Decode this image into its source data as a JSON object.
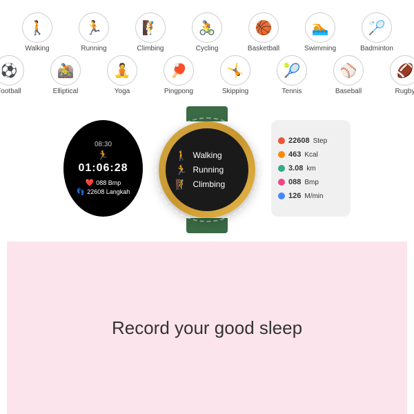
{
  "activities_row1": [
    {
      "label": "Walking",
      "icon": "🚶"
    },
    {
      "label": "Running",
      "icon": "🏃"
    },
    {
      "label": "Climbing",
      "icon": "🧗"
    },
    {
      "label": "Cycling",
      "icon": "🚴"
    },
    {
      "label": "Basketball",
      "icon": "🏀"
    },
    {
      "label": "Swimming",
      "icon": "🏊"
    },
    {
      "label": "Badminton",
      "icon": "🏸"
    }
  ],
  "activities_row2": [
    {
      "label": "Football",
      "icon": "⚽"
    },
    {
      "label": "Elliptical",
      "icon": "🚴"
    },
    {
      "label": "Yoga",
      "icon": "🧘"
    },
    {
      "label": "Pingpong",
      "icon": "🏓"
    },
    {
      "label": "Skipping",
      "icon": "🤸"
    },
    {
      "label": "Tennis",
      "icon": "🎾"
    },
    {
      "label": "Baseball",
      "icon": "⚾"
    },
    {
      "label": "Rugby",
      "icon": "🏈"
    }
  ],
  "stats_left": {
    "time_small": "08:30",
    "time_big": "01:06:28",
    "heart_label": "088 Bmp",
    "steps_label": "22608 Langkah"
  },
  "watch_menu": [
    {
      "label": "Walking"
    },
    {
      "label": "Running"
    },
    {
      "label": "Climbing"
    }
  ],
  "stats_right": [
    {
      "color": "dot-red",
      "value": "22608",
      "unit": "Step"
    },
    {
      "color": "dot-orange",
      "value": "463",
      "unit": "Kcal"
    },
    {
      "color": "dot-green",
      "value": "3.08",
      "unit": "km"
    },
    {
      "color": "dot-pink",
      "value": "088",
      "unit": "Bmp"
    },
    {
      "color": "dot-blue",
      "value": "126",
      "unit": "M/min"
    }
  ],
  "sleep_text": "Record your good sleep"
}
